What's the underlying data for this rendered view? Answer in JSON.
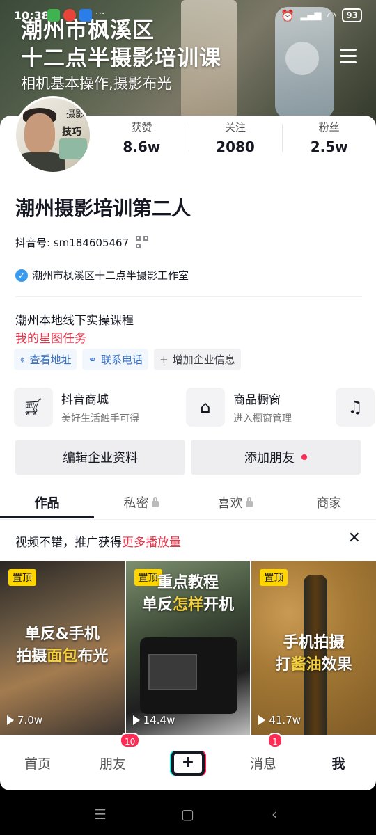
{
  "status_bar": {
    "time": "10:38",
    "battery": "93"
  },
  "banner": {
    "title_line1": "潮州市枫溪区",
    "title_line2": "十二点半摄影培训课",
    "subtitle": "相机基本操作,摄影布光"
  },
  "avatar": {
    "text1": "摄影",
    "text2": "技巧"
  },
  "stats": [
    {
      "label": "获赞",
      "value": "8.6w"
    },
    {
      "label": "关注",
      "value": "2080"
    },
    {
      "label": "粉丝",
      "value": "2.5w"
    }
  ],
  "profile": {
    "nickname": "潮州摄影培训第二人",
    "douyin_id": "抖音号: sm184605467",
    "verified_name": "潮州市枫溪区十二点半摄影工作室",
    "bio": "潮州本地线下实操课程",
    "task_link": "我的星图任务"
  },
  "chips": [
    {
      "label": "查看地址",
      "icon": "location-icon"
    },
    {
      "label": "联系电话",
      "icon": "link-icon"
    },
    {
      "label": "增加企业信息",
      "icon": "plus-icon"
    }
  ],
  "services": [
    {
      "title": "抖音商城",
      "subtitle": "美好生活触手可得",
      "icon": "cart-icon"
    },
    {
      "title": "商品橱窗",
      "subtitle": "进入橱窗管理",
      "icon": "store-icon"
    },
    {
      "title": "",
      "subtitle": "",
      "icon": "music-icon"
    }
  ],
  "buttons": {
    "edit": "编辑企业资料",
    "add_friend": "添加朋友"
  },
  "tabs": [
    {
      "label": "作品",
      "active": true,
      "locked": false
    },
    {
      "label": "私密",
      "active": false,
      "locked": true
    },
    {
      "label": "喜欢",
      "active": false,
      "locked": true
    },
    {
      "label": "商家",
      "active": false,
      "locked": false
    }
  ],
  "promo": {
    "text": "视频不错，推广获得",
    "highlight": "更多播放量"
  },
  "videos": [
    {
      "pin": "置顶",
      "line1": "单反&手机",
      "line2a": "拍摄",
      "line2b": "面包",
      "line2c": "布光",
      "plays": "7.0w"
    },
    {
      "pin": "置顶",
      "line1": "重点教程",
      "line2a": "单反",
      "line2b": "怎样",
      "line2c": "开机",
      "plays": "14.4w"
    },
    {
      "pin": "置顶",
      "line1": "手机拍摄",
      "line2a": "打",
      "line2b": "酱油",
      "line2c": "效果",
      "plays": "41.7w"
    }
  ],
  "bottom_nav": [
    {
      "label": "首页",
      "badge": ""
    },
    {
      "label": "朋友",
      "badge": "10"
    },
    {
      "label": "+",
      "badge": ""
    },
    {
      "label": "消息",
      "badge": "1"
    },
    {
      "label": "我",
      "badge": ""
    }
  ],
  "colors": {
    "accent": "#fe2c55",
    "link": "#3a73c6",
    "highlight": "#e6344a",
    "pin": "#ffd500"
  }
}
